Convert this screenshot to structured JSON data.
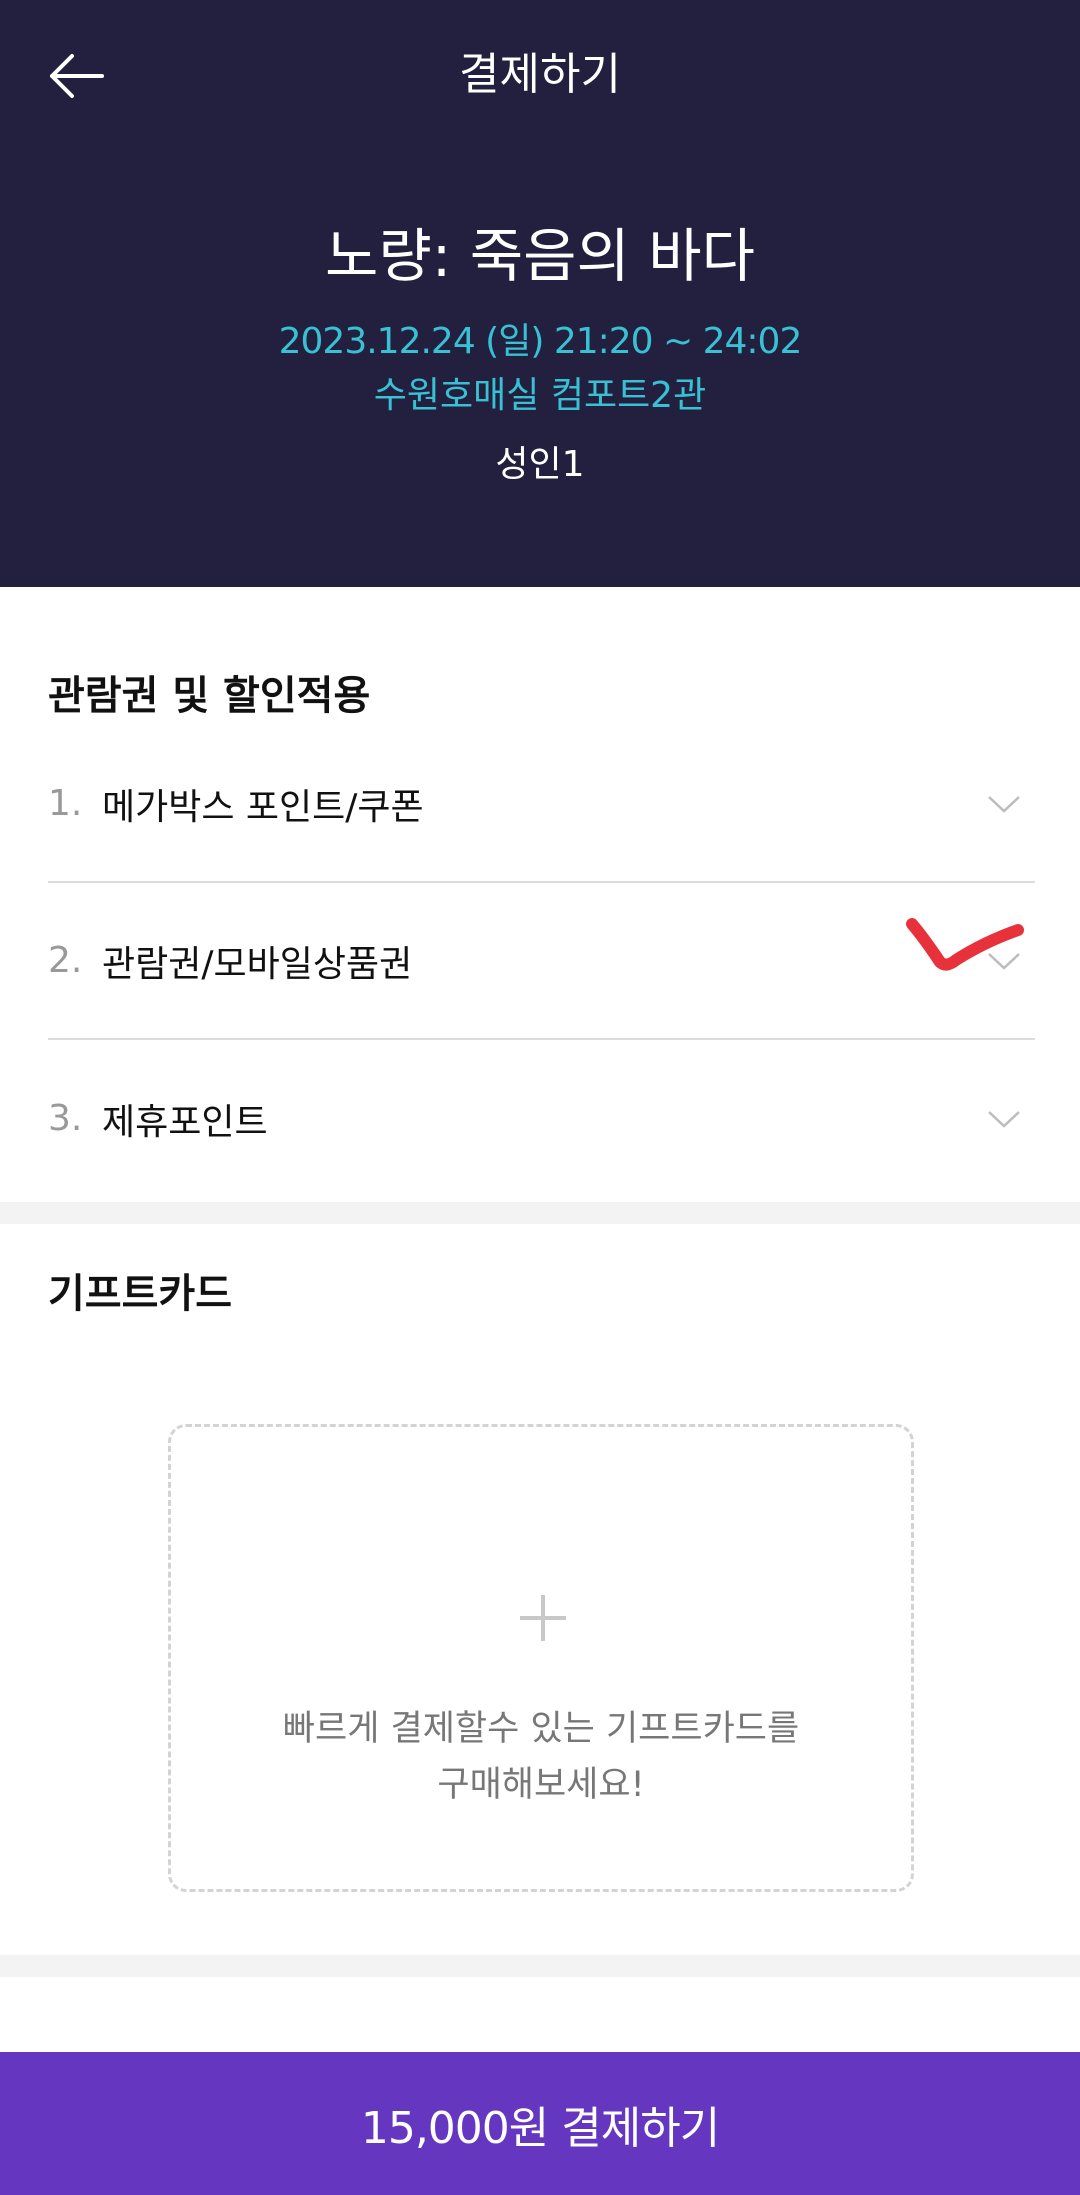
{
  "header": {
    "title": "결제하기",
    "movie_title": "노량: 죽음의 바다",
    "showtime": "2023.12.24 (일) 21:20 ~ 24:02",
    "theater": "수원호매실 컴포트2관",
    "audience": "성인1"
  },
  "discount": {
    "title": "관람권 및 할인적용",
    "items": [
      {
        "number": "1.",
        "label": "메가박스 포인트/쿠폰"
      },
      {
        "number": "2.",
        "label": "관람권/모바일상품권"
      },
      {
        "number": "3.",
        "label": "제휴포인트"
      }
    ]
  },
  "giftcard": {
    "title": "기프트카드",
    "prompt_line1": "빠르게 결제할수 있는 기프트카드를",
    "prompt_line2": "구매해보세요!"
  },
  "footer": {
    "pay_label": "15,000원 결제하기"
  },
  "colors": {
    "header_bg": "#231f3e",
    "accent_cyan": "#38c1d3",
    "pay_button": "#6537c1",
    "annotation_red": "#e8323b"
  },
  "icons": {
    "back": "back-arrow-icon",
    "chevron": "chevron-down-icon",
    "plus": "plus-icon"
  }
}
